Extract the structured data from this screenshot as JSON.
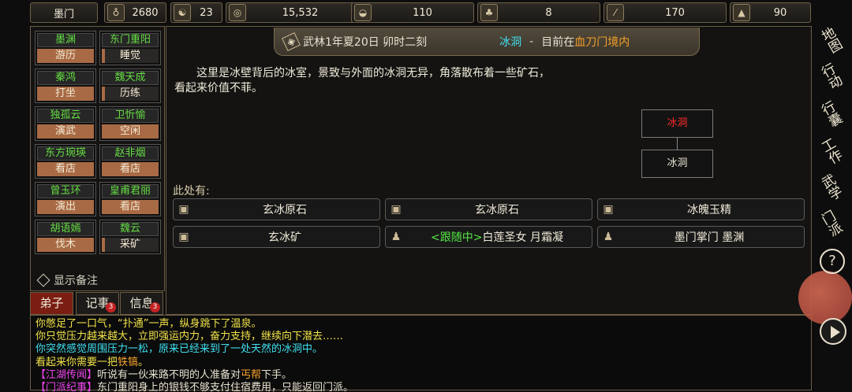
{
  "top_bar": {
    "sect_name": "墨门",
    "resources": [
      {
        "icon": "money-pouch-icon",
        "value": "2680"
      },
      {
        "icon": "yin-yang-icon",
        "value": "23"
      },
      {
        "icon": "coin-icon",
        "value": "15,532"
      },
      {
        "icon": "food-bowl-icon",
        "value": "110"
      },
      {
        "icon": "herb-icon",
        "value": "8"
      },
      {
        "icon": "wood-icon",
        "value": "170"
      },
      {
        "icon": "ore-icon",
        "value": "90"
      }
    ]
  },
  "disciples": [
    {
      "name": "墨渊",
      "status": "游历",
      "active": true
    },
    {
      "name": "东门重阳",
      "status": "睡觉",
      "active": false
    },
    {
      "name": "秦鸿",
      "status": "打坐",
      "active": true
    },
    {
      "name": "魏天成",
      "status": "历练",
      "active": false
    },
    {
      "name": "独孤云",
      "status": "演武",
      "active": true
    },
    {
      "name": "卫忻愉",
      "status": "空闲",
      "active": true
    },
    {
      "name": "东方琬瑛",
      "status": "看店",
      "active": true
    },
    {
      "name": "赵非烟",
      "status": "看店",
      "active": true
    },
    {
      "name": "曾玉环",
      "status": "演出",
      "active": true
    },
    {
      "name": "皇甫君丽",
      "status": "看店",
      "active": true
    },
    {
      "name": "胡语嫣",
      "status": "伐木",
      "active": true
    },
    {
      "name": "魏云",
      "status": "采矿",
      "active": false
    }
  ],
  "show_notes_label": "显示备注",
  "bottom_tabs": [
    {
      "label": "弟子",
      "badge": ""
    },
    {
      "label": "记事",
      "badge": "3"
    },
    {
      "label": "信息",
      "badge": "3"
    }
  ],
  "header": {
    "date": "武林1年夏20日 卯时二刻",
    "location": "冰洞",
    "separator": "-",
    "prefix": "目前在",
    "region": "血刀门境内"
  },
  "description": "这里是冰壁背后的冰室，景致与外面的冰洞无异，角落散布着一些矿石，看起来价值不菲。",
  "minimap": {
    "current": "冰洞",
    "adjacent": "冰洞"
  },
  "here_label": "此处有:",
  "items": [
    {
      "icon": "box-icon",
      "label": "玄冰原石"
    },
    {
      "icon": "box-icon",
      "label": "玄冰原石"
    },
    {
      "icon": "box-icon",
      "label": "冰魄玉精"
    },
    {
      "icon": "box-icon",
      "label": "玄冰矿"
    },
    {
      "icon": "person-icon",
      "follow_tag": "<跟随中>",
      "label": "白莲圣女 月霜凝"
    },
    {
      "icon": "person-icon",
      "label": "墨门掌门 墨渊"
    }
  ],
  "log": [
    {
      "parts": [
        {
          "text": "你憋足了一口气，“扑通”一声，纵身跳下了温泉。",
          "color": "yellow"
        }
      ]
    },
    {
      "parts": [
        {
          "text": "你只觉压力越来越大，立即强运内力，奋力支持，继续向下潜去……",
          "color": "yellow"
        }
      ]
    },
    {
      "parts": [
        {
          "text": "你突然感觉周围压力一松，原来已经来到了一处天然的冰洞中。",
          "color": "cyan"
        }
      ]
    },
    {
      "parts": [
        {
          "text": "看起来你需要一把",
          "color": "yellow"
        },
        {
          "text": "铁镐",
          "color": "orange"
        },
        {
          "text": "。",
          "color": "yellow"
        }
      ]
    },
    {
      "parts": [
        {
          "text": "【江湖传闻】",
          "color": "pink"
        },
        {
          "text": "听说有一伙来路不明的人准备对",
          "color": "white"
        },
        {
          "text": "丐帮",
          "color": "orange"
        },
        {
          "text": "下手。",
          "color": "white"
        }
      ]
    },
    {
      "parts": [
        {
          "text": "【门派纪事】",
          "color": "pink"
        },
        {
          "text": "东门重阳身上的银钱不够支付住宿费用，只能返回门派。",
          "color": "white"
        }
      ]
    }
  ],
  "side_nav": [
    "地图",
    "行动",
    "行囊",
    "工作",
    "武学",
    "门派"
  ],
  "help_icon": "?"
}
